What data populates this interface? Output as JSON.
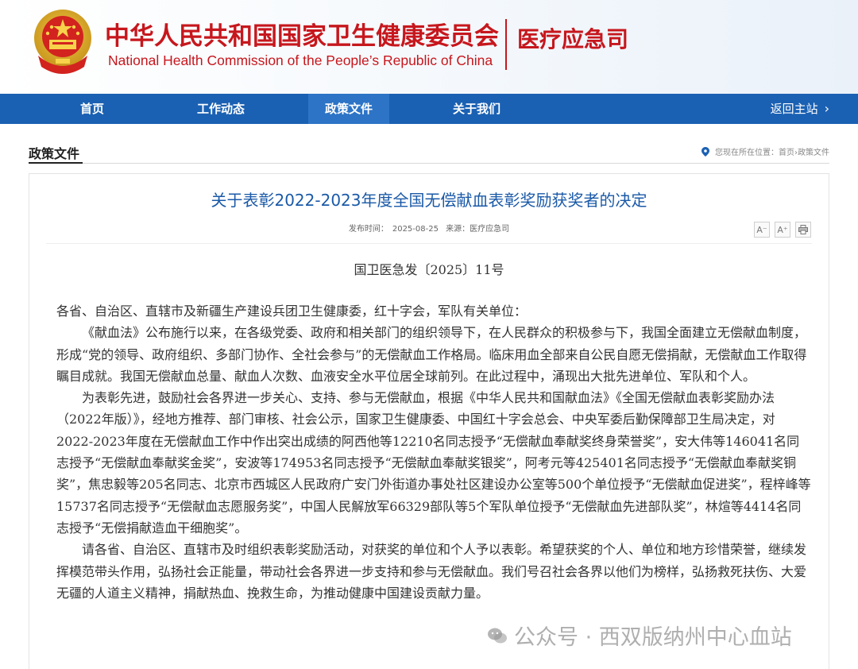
{
  "header": {
    "cn_title": "中华人民共和国国家卫生健康委员会",
    "en_title": "National Health Commission of the People’s Republic of China",
    "sub_site": "医疗应急司"
  },
  "nav": {
    "items": [
      {
        "label": "首页",
        "active": false
      },
      {
        "label": "工作动态",
        "active": false
      },
      {
        "label": "政策文件",
        "active": true
      },
      {
        "label": "关于我们",
        "active": false
      }
    ],
    "back_label": "返回主站"
  },
  "section": {
    "title": "政策文件",
    "breadcrumb": "您现在所在位置：首页›政策文件"
  },
  "article": {
    "title": "关于表彰2022-2023年度全国无偿献血表彰奖励获奖者的决定",
    "meta_date": "发布时间：　2025-08-25",
    "meta_source": "来源：医疗应急司",
    "tools": [
      "A⁻",
      "A⁺",
      "print-icon"
    ],
    "doc_no": "国卫医急发〔2025〕11号",
    "paragraphs": [
      "各省、自治区、直辖市及新疆生产建设兵团卫生健康委，红十字会，军队有关单位：",
      "《献血法》公布施行以来，在各级党委、政府和相关部门的组织领导下，在人民群众的积极参与下，我国全面建立无偿献血制度，形成“党的领导、政府组织、多部门协作、全社会参与”的无偿献血工作格局。临床用血全部来自公民自愿无偿捐献，无偿献血工作取得瞩目成就。我国无偿献血总量、献血人次数、血液安全水平位居全球前列。在此过程中，涌现出大批先进单位、军队和个人。",
      "为表彰先进，鼓励社会各界进一步关心、支持、参与无偿献血，根据《中华人民共和国献血法》《全国无偿献血表彰奖励办法（2022年版）》，经地方推荐、部门审核、社会公示，国家卫生健康委、中国红十字会总会、中央军委后勤保障部卫生局决定，对2022-2023年度在无偿献血工作中作出突出成绩的阿西他等12210名同志授予“无偿献血奉献奖终身荣誉奖”，安大伟等146041名同志授予“无偿献血奉献奖金奖”，安波等174953名同志授予“无偿献血奉献奖银奖”，阿考元等425401名同志授予“无偿献血奉献奖铜奖”，焦忠毅等205名同志、北京市西城区人民政府广安门外街道办事处社区建设办公室等500个单位授予“无偿献血促进奖”，程梓峰等15737名同志授予“无偿献血志愿服务奖”，中国人民解放军66329部队等5个军队单位授予“无偿献血先进部队奖”，林煊等4414名同志授予“无偿捐献造血干细胞奖”。",
      "请各省、自治区、直辖市及时组织表彰奖励活动，对获奖的单位和个人予以表彰。希望获奖的个人、单位和地方珍惜荣誉，继续发挥模范带头作用，弘扬社会正能量，带动社会各界进一步支持和参与无偿献血。我们号召社会各界以他们为榜样，弘扬救死扶伤、大爱无疆的人道主义精神，捐献热血、挽救生命，为推动健康中国建设贡献力量。"
    ]
  },
  "watermark": {
    "text": "公众号 · 西双版纳州中心血站"
  },
  "colors": {
    "brand_red": "#c6171d",
    "nav_blue": "#1b61b3",
    "title_blue": "#1b5aa8"
  }
}
